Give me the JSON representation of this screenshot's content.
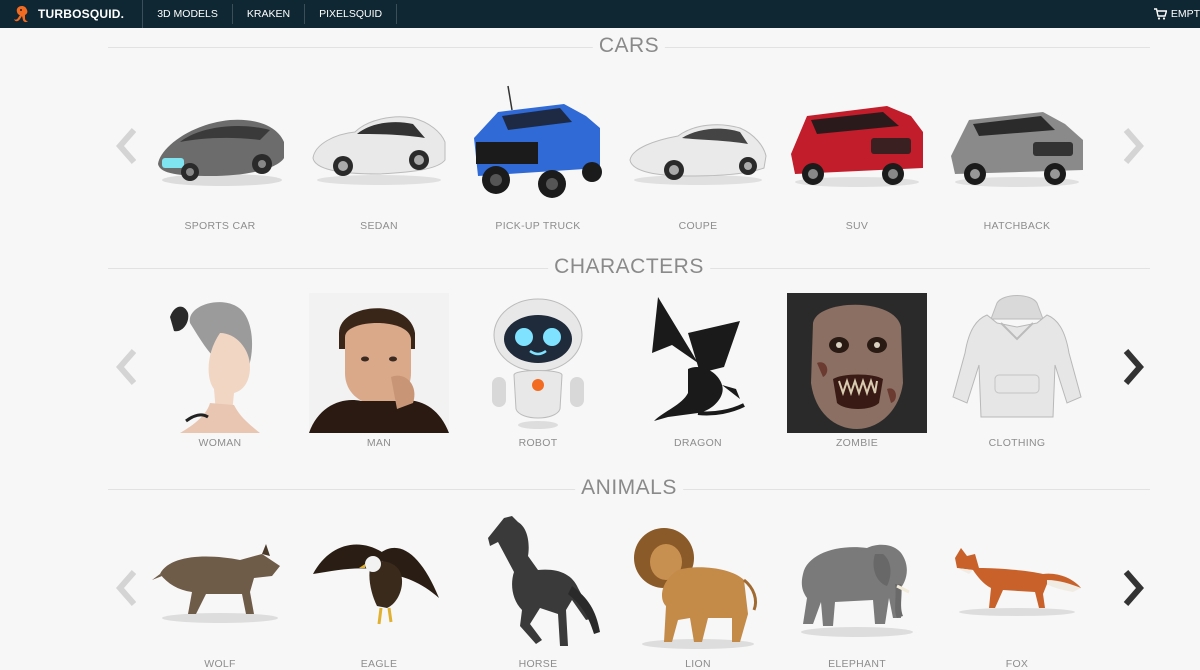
{
  "nav": {
    "brand": "TURBOSQUID.",
    "items": [
      "3D MODELS",
      "KRAKEN",
      "PIXELSQUID"
    ],
    "cart_label": "EMPT"
  },
  "colors": {
    "nav_bg": "#0f2733",
    "page_bg": "#f7f7f7",
    "accent": "#f26b21"
  },
  "sections": [
    {
      "title": "CARS",
      "items": [
        {
          "label": "SPORTS CAR",
          "icon": "sports-car-icon"
        },
        {
          "label": "SEDAN",
          "icon": "sedan-icon"
        },
        {
          "label": "PICK-UP TRUCK",
          "icon": "pickup-truck-icon"
        },
        {
          "label": "COUPE",
          "icon": "coupe-icon"
        },
        {
          "label": "SUV",
          "icon": "suv-icon"
        },
        {
          "label": "HATCHBACK",
          "icon": "hatchback-icon"
        }
      ]
    },
    {
      "title": "CHARACTERS",
      "items": [
        {
          "label": "WOMAN",
          "icon": "woman-icon"
        },
        {
          "label": "MAN",
          "icon": "man-icon"
        },
        {
          "label": "ROBOT",
          "icon": "robot-icon"
        },
        {
          "label": "DRAGON",
          "icon": "dragon-icon"
        },
        {
          "label": "ZOMBIE",
          "icon": "zombie-icon"
        },
        {
          "label": "CLOTHING",
          "icon": "clothing-icon"
        }
      ]
    },
    {
      "title": "ANIMALS",
      "items": [
        {
          "label": "WOLF",
          "icon": "wolf-icon"
        },
        {
          "label": "EAGLE",
          "icon": "eagle-icon"
        },
        {
          "label": "HORSE",
          "icon": "horse-icon"
        },
        {
          "label": "LION",
          "icon": "lion-icon"
        },
        {
          "label": "ELEPHANT",
          "icon": "elephant-icon"
        },
        {
          "label": "FOX",
          "icon": "fox-icon"
        }
      ]
    }
  ]
}
